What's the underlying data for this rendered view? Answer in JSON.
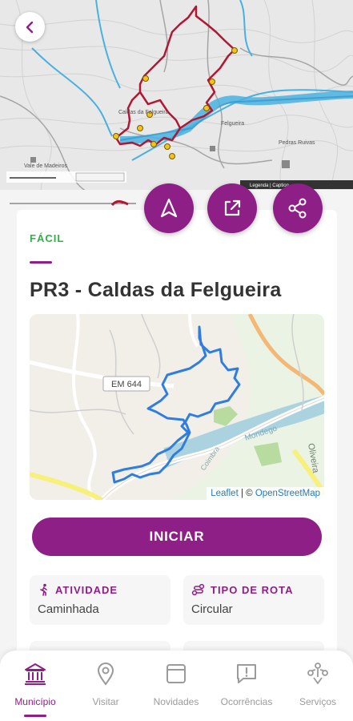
{
  "route": {
    "difficulty": "FÁCIL",
    "title": "PR3 - Caldas da Felgueira",
    "start_label": "INICIAR"
  },
  "map": {
    "attribution_leaflet": "Leaflet",
    "attribution_sep": " | © ",
    "attribution_osm": "OpenStreetMap",
    "road_label": "EM 644",
    "place_label": "Oliveira",
    "river_label": "Mondego",
    "village_label": "Coimbra"
  },
  "topo": {
    "place_felgueira": "Felgueira",
    "place_caldas": "Caldas da Felgueira",
    "place_vale": "Vale de Madeiros",
    "place_pedras": "Pedras Ruivas",
    "legend": "Legenda | Caption"
  },
  "info": {
    "activity_label": "ATIVIDADE",
    "activity_value": "Caminhada",
    "route_type_label": "TIPO DE ROTA",
    "route_type_value": "Circular"
  },
  "nav": [
    {
      "label": "Município",
      "icon": "institution-icon",
      "active": true
    },
    {
      "label": "Visitar",
      "icon": "location-pin-icon",
      "active": false
    },
    {
      "label": "Novidades",
      "icon": "news-icon",
      "active": false
    },
    {
      "label": "Ocorrências",
      "icon": "alert-message-icon",
      "active": false
    },
    {
      "label": "Serviços",
      "icon": "services-icon",
      "active": false
    }
  ],
  "colors": {
    "brand": "#8e1f86",
    "easy": "#2fb14a",
    "route_line": "#2f7de1",
    "topo_route": "#b01732"
  }
}
